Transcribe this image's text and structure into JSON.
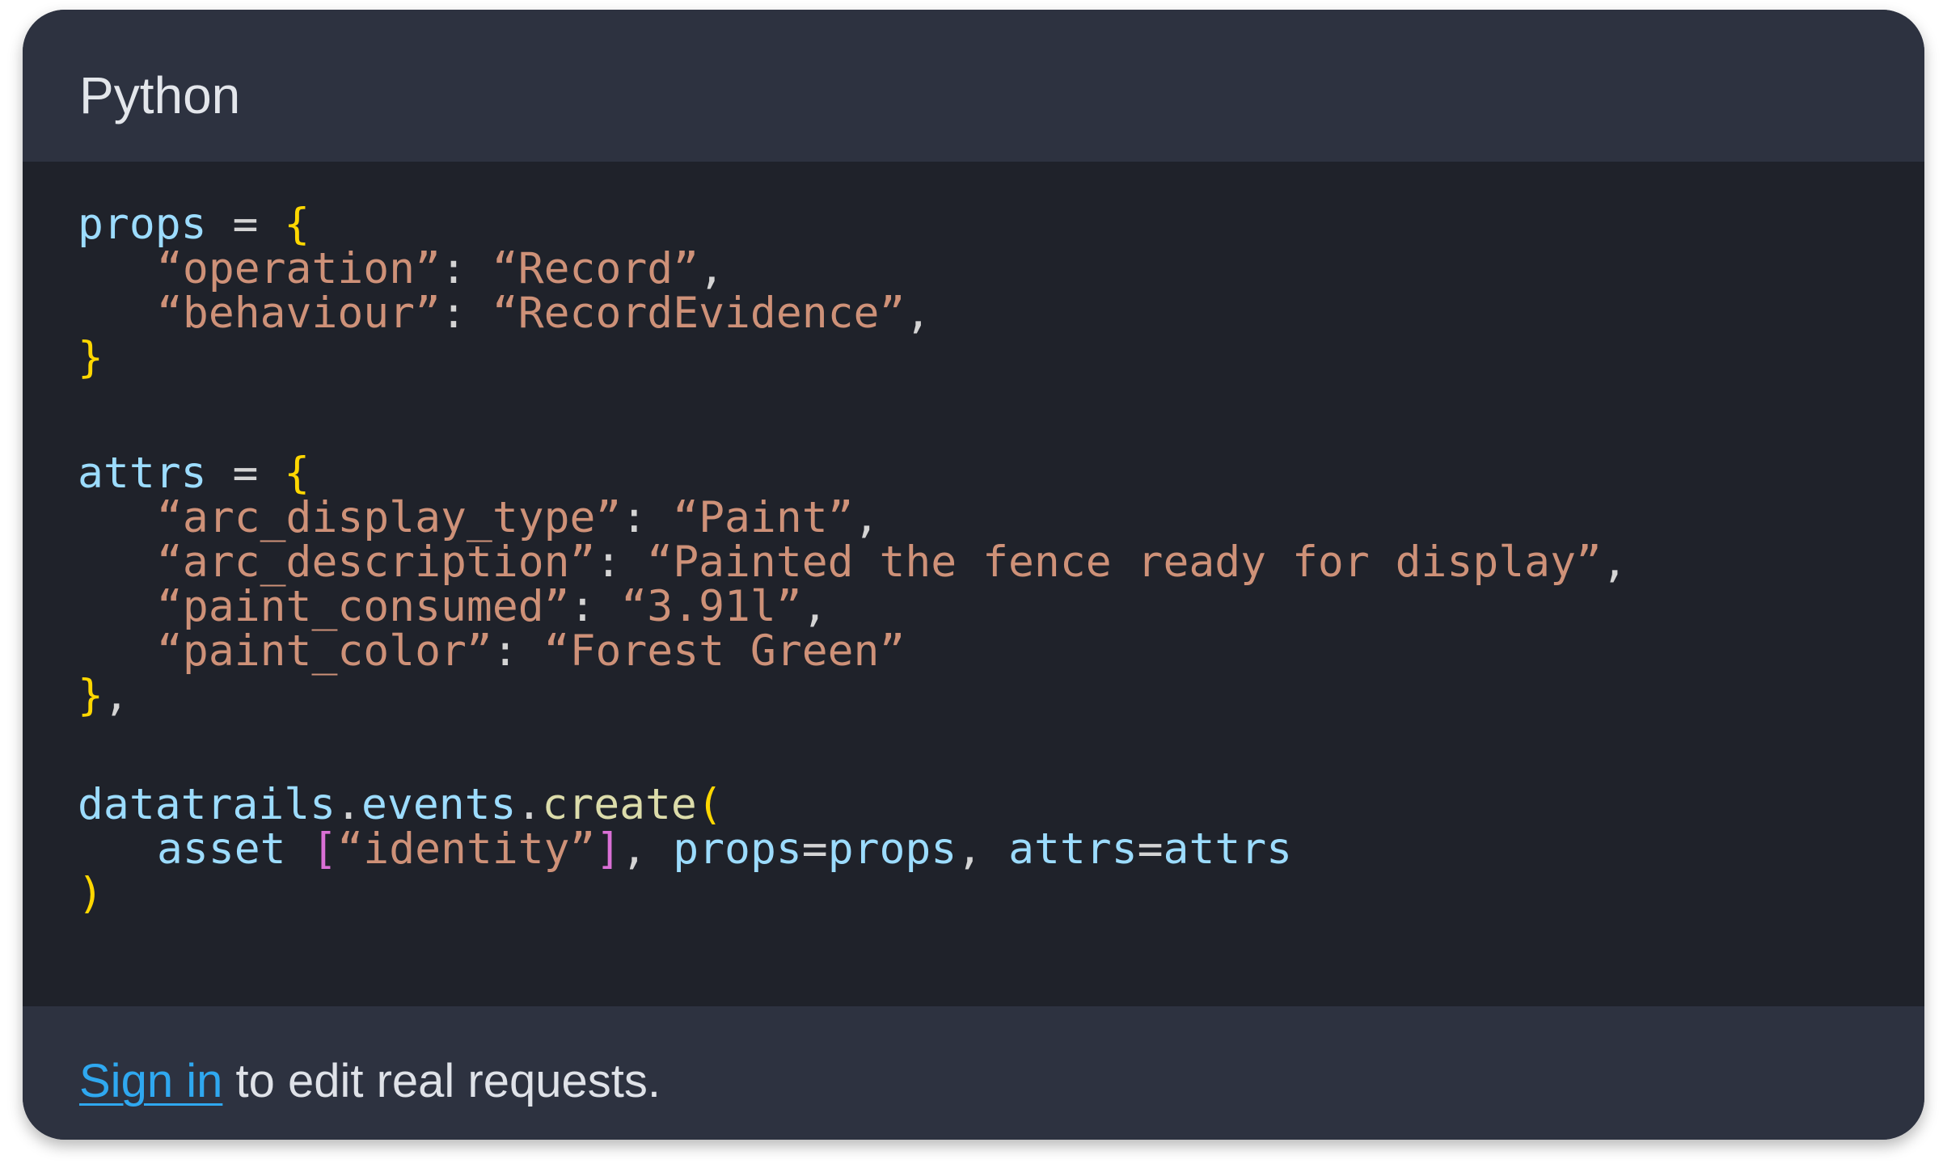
{
  "header": {
    "language": "Python"
  },
  "code": {
    "lines": [
      [
        [
          "var",
          "props"
        ],
        [
          "op",
          " = "
        ],
        [
          "br",
          "{"
        ]
      ],
      [
        [
          "str",
          "“operation”"
        ],
        [
          "op",
          ": "
        ],
        [
          "str",
          "“Record”"
        ],
        [
          "op",
          ","
        ]
      ],
      [
        [
          "str",
          "“behaviour”"
        ],
        [
          "op",
          ": "
        ],
        [
          "str",
          "“RecordEvidence”"
        ],
        [
          "op",
          ","
        ]
      ],
      [
        [
          "br",
          "}"
        ]
      ],
      [
        [
          "var",
          "attrs"
        ],
        [
          "op",
          " = "
        ],
        [
          "br",
          "{"
        ]
      ],
      [
        [
          "str",
          "“arc_display_type”"
        ],
        [
          "op",
          ": "
        ],
        [
          "str",
          "“Paint”"
        ],
        [
          "op",
          ","
        ]
      ],
      [
        [
          "str",
          "“arc_description”"
        ],
        [
          "op",
          ": "
        ],
        [
          "str",
          "“Painted the fence ready for display”"
        ],
        [
          "op",
          ","
        ]
      ],
      [
        [
          "str",
          "“paint_consumed”"
        ],
        [
          "op",
          ": "
        ],
        [
          "str",
          "“3.91l”"
        ],
        [
          "op",
          ","
        ]
      ],
      [
        [
          "str",
          "“paint_color”"
        ],
        [
          "op",
          ": "
        ],
        [
          "str",
          "“Forest Green”"
        ]
      ],
      [
        [
          "br",
          "}"
        ],
        [
          "op",
          ","
        ]
      ],
      [
        [
          "var",
          "datatrails"
        ],
        [
          "op",
          "."
        ],
        [
          "var",
          "events"
        ],
        [
          "op",
          "."
        ],
        [
          "fn",
          "create"
        ],
        [
          "br",
          "("
        ]
      ],
      [
        [
          "var",
          "asset "
        ],
        [
          "br2",
          "["
        ],
        [
          "str",
          "“identity”"
        ],
        [
          "br2",
          "]"
        ],
        [
          "op",
          ", "
        ],
        [
          "var",
          "props"
        ],
        [
          "op",
          "="
        ],
        [
          "var",
          "props"
        ],
        [
          "op",
          ", "
        ],
        [
          "var",
          "attrs"
        ],
        [
          "op",
          "="
        ],
        [
          "var",
          "attrs"
        ]
      ],
      [
        [
          "br",
          ")"
        ]
      ]
    ]
  },
  "footer": {
    "link_label": "Sign in",
    "rest_text": " to edit real requests."
  },
  "colors": {
    "card_bg": "#2d3240",
    "code_bg": "#1f222a",
    "variable": "#9cdcfe",
    "string": "#ce9178",
    "brace": "#ffd700",
    "bracket": "#da70d6",
    "function": "#dcdcaa",
    "link": "#2fa8f0"
  }
}
